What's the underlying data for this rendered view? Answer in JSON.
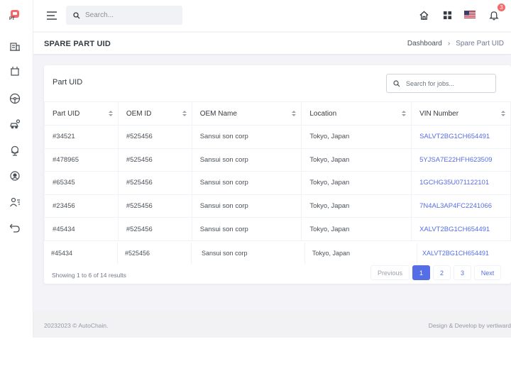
{
  "sidebar": {
    "logo_text": "PT",
    "items": [
      {
        "icon": "building-icon"
      },
      {
        "icon": "parts-bin-icon"
      },
      {
        "icon": "steering-wheel-icon"
      },
      {
        "icon": "car-service-icon"
      },
      {
        "icon": "globe-stand-icon"
      },
      {
        "icon": "location-user-icon"
      },
      {
        "icon": "users-list-icon"
      },
      {
        "icon": "undo-icon"
      }
    ]
  },
  "topbar": {
    "search_placeholder": "Search...",
    "notification_count": "3"
  },
  "page": {
    "title": "SPARE PART UID",
    "breadcrumb": [
      "Dashboard",
      "Spare Part UID"
    ]
  },
  "card": {
    "title": "Part UID",
    "search_placeholder": "Search for jobs..."
  },
  "table": {
    "columns": [
      "Part UID",
      "OEM ID",
      "OEM Name",
      "Location",
      "VIN Number"
    ],
    "rows": [
      [
        "#34521",
        "#525456",
        "Sansui son corp",
        "Tokyo, Japan",
        "SALVT2BG1CH654491"
      ],
      [
        "#478965",
        "#525456",
        "Sansui son corp",
        "Tokyo, Japan",
        "5YJSA7E22HFH623509"
      ],
      [
        "#65345",
        "#525456",
        "Sansui son corp",
        "Tokyo, Japan",
        "1GCHG35U071122101"
      ],
      [
        "#23456",
        "#525456",
        "Sansui son corp",
        "Tokyo, Japan",
        "7N4AL3AP4FC2241066"
      ],
      [
        "#45434",
        "#525456",
        "Sansui son corp",
        "Tokyo, Japan",
        "XALVT2BG1CH654491"
      ]
    ],
    "ghost_row": [
      "#45434",
      "#525456",
      "Sansui son corp",
      "Tokyo, Japan",
      "XALVT2BG1CH654491"
    ]
  },
  "pagination": {
    "showing": "Showing 1 to 6 of 14 results",
    "previous": "Previous",
    "pages": [
      "1",
      "2",
      "3"
    ],
    "next": "Next"
  },
  "footer": {
    "left": "20232023 © AutoChain.",
    "right": "Design & Develop by vertiward"
  },
  "colors": {
    "accent": "#556ee6",
    "badge": "#f46a6a",
    "background": "#f3f3f8"
  }
}
